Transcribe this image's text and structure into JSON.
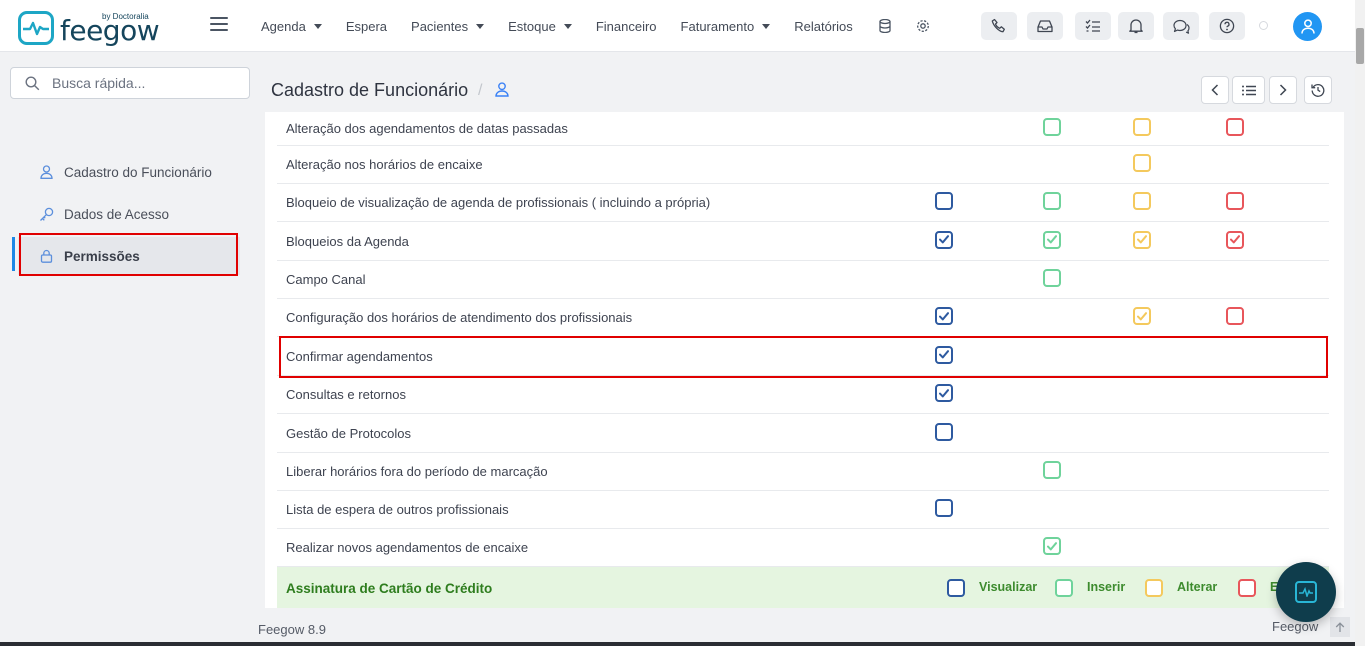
{
  "logo": {
    "word": "feegow",
    "by": "by Doctoralia"
  },
  "nav": {
    "items": [
      {
        "label": "Agenda",
        "dropdown": true
      },
      {
        "label": "Espera",
        "dropdown": false
      },
      {
        "label": "Pacientes",
        "dropdown": true
      },
      {
        "label": "Estoque",
        "dropdown": true
      },
      {
        "label": "Financeiro",
        "dropdown": false
      },
      {
        "label": "Faturamento",
        "dropdown": true
      },
      {
        "label": "Relatórios",
        "dropdown": false
      }
    ],
    "extra_icons": [
      "database-icon",
      "gear-icon"
    ]
  },
  "toolbar_icons": [
    "phone-icon",
    "inbox-icon",
    "checklist-icon",
    "bell-icon",
    "chat-icon",
    "help-icon"
  ],
  "search": {
    "placeholder": "Busca rápida..."
  },
  "sidebar": {
    "items": [
      {
        "label": "Cadastro do Funcionário",
        "icon": "user-icon",
        "active": false
      },
      {
        "label": "Dados de Acesso",
        "icon": "key-icon",
        "active": false
      },
      {
        "label": "Permissões",
        "icon": "lock-icon",
        "active": true
      }
    ]
  },
  "page": {
    "title": "Cadastro de Funcionário",
    "separator": "/"
  },
  "pager_icons": [
    "chevron-left-icon",
    "list-icon",
    "chevron-right-icon",
    "history-icon"
  ],
  "permissions": [
    {
      "label": "Alteração dos agendamentos de datas passadas",
      "v": null,
      "i": false,
      "a": false,
      "e": false
    },
    {
      "label": "Alteração nos horários de encaixe",
      "v": null,
      "i": null,
      "a": false,
      "e": null
    },
    {
      "label": "Bloqueio de visualização de agenda de profissionais ( incluindo a própria)",
      "v": false,
      "i": false,
      "a": false,
      "e": false
    },
    {
      "label": "Bloqueios da Agenda",
      "v": true,
      "i": true,
      "a": true,
      "e": true
    },
    {
      "label": "Campo Canal",
      "v": null,
      "i": false,
      "a": null,
      "e": null
    },
    {
      "label": "Configuração dos horários de atendimento dos profissionais",
      "v": true,
      "i": null,
      "a": true,
      "e": false
    },
    {
      "label": "Confirmar agendamentos",
      "v": true,
      "i": null,
      "a": null,
      "e": null
    },
    {
      "label": "Consultas e retornos",
      "v": true,
      "i": null,
      "a": null,
      "e": null
    },
    {
      "label": "Gestão de Protocolos",
      "v": false,
      "i": null,
      "a": null,
      "e": null
    },
    {
      "label": "Liberar horários fora do período de marcação",
      "v": null,
      "i": false,
      "a": null,
      "e": null
    },
    {
      "label": "Lista de espera de outros profissionais",
      "v": false,
      "i": null,
      "a": null,
      "e": null
    },
    {
      "label": "Realizar novos agendamentos de encaixe",
      "v": null,
      "i": true,
      "a": null,
      "e": null
    }
  ],
  "section": {
    "title": "Assinatura de Cartão de Crédito",
    "headers": {
      "v": "Visualizar",
      "i": "Inserir",
      "a": "Alterar",
      "e": "E"
    }
  },
  "footer": {
    "version": "Feegow 8.9",
    "brand": "Feegow"
  },
  "colors": {
    "visualizar": "#2e5aa0",
    "inserir": "#6fd39b",
    "alterar": "#f4c95d",
    "excluir": "#e8565b",
    "accent": "#2196f3",
    "section_bg": "#e5f5e0",
    "highlight": "#e00000"
  }
}
